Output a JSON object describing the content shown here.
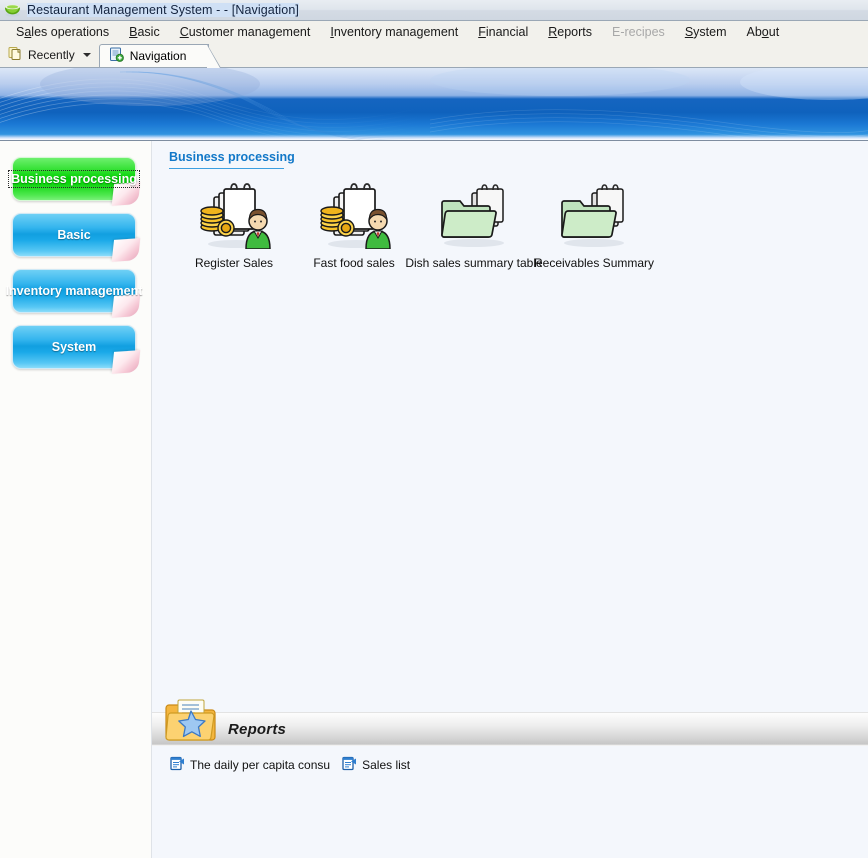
{
  "window": {
    "title": "Restaurant Management System -  - [Navigation]",
    "app_icon": "green-bowl-icon"
  },
  "menubar": {
    "items": [
      {
        "label": "Sales operations",
        "accel_index": 1,
        "disabled": false
      },
      {
        "label": "Basic",
        "accel_index": 0,
        "disabled": false
      },
      {
        "label": "Customer management",
        "accel_index": 0,
        "disabled": false
      },
      {
        "label": "Inventory management",
        "accel_index": 0,
        "disabled": false
      },
      {
        "label": "Financial",
        "accel_index": 0,
        "disabled": false
      },
      {
        "label": "Reports",
        "accel_index": 0,
        "disabled": false
      },
      {
        "label": "E-recipes",
        "accel_index": -1,
        "disabled": true
      },
      {
        "label": "System",
        "accel_index": 0,
        "disabled": false
      },
      {
        "label": "About",
        "accel_index": 2,
        "disabled": false
      }
    ]
  },
  "tabstrip": {
    "recently_label": "Recently",
    "recently_icon": "copy-pages-icon",
    "dropdown_icon": "chevron-down-icon",
    "tabs": [
      {
        "label": "Navigation",
        "icon": "document-add-icon",
        "active": true
      }
    ]
  },
  "sidebar": {
    "items": [
      {
        "label": "Business processing",
        "color": "#05d005",
        "selected": true
      },
      {
        "label": "Basic",
        "color": "#119fe0",
        "selected": false
      },
      {
        "label": "Inventory management",
        "color": "#119fe0",
        "selected": false
      },
      {
        "label": "System",
        "color": "#119fe0",
        "selected": false
      }
    ]
  },
  "main": {
    "section_title": "Business processing",
    "tiles": [
      {
        "label": "Register Sales",
        "icon": "clipboard-coins-person-icon"
      },
      {
        "label": "Fast food sales",
        "icon": "clipboard-coins-person-icon"
      },
      {
        "label": "Dish sales summary table",
        "icon": "green-folder-clipboard-icon"
      },
      {
        "label": "Receivables Summary",
        "icon": "green-folder-clipboard-icon"
      }
    ]
  },
  "reports": {
    "band_label": "Reports",
    "band_icon": "yellow-folder-star-icon",
    "links": [
      {
        "label": "The daily per capita consu",
        "icon": "report-clipboard-icon"
      },
      {
        "label": "Sales list",
        "icon": "report-clipboard-icon"
      }
    ]
  },
  "colors": {
    "accent_blue": "#1278c8",
    "banner_blue": "#0f62bd",
    "selected_green": "#05d005",
    "button_blue": "#119fe0",
    "content_bg": "#f4f7fc",
    "sidebar_bg": "#fcfcfa"
  }
}
